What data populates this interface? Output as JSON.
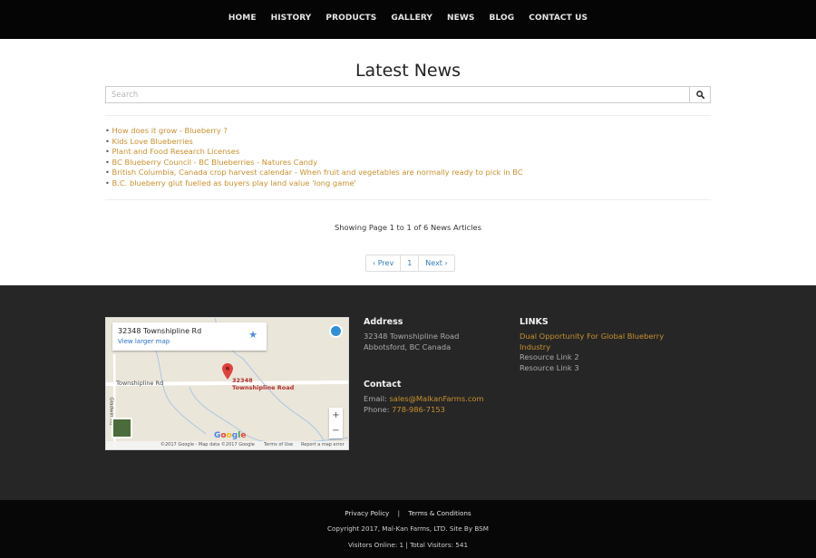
{
  "nav": {
    "items": [
      {
        "label": "HOME"
      },
      {
        "label": "HISTORY"
      },
      {
        "label": "PRODUCTS"
      },
      {
        "label": "GALLERY"
      },
      {
        "label": "NEWS"
      },
      {
        "label": "BLOG"
      },
      {
        "label": "CONTACT US"
      }
    ]
  },
  "main": {
    "title": "Latest News",
    "search_placeholder": "Search",
    "search_icon": "search-icon",
    "bullet": "•",
    "articles": [
      {
        "title": "How does it grow - Blueberry ?"
      },
      {
        "title": "Kids Love Blueberries"
      },
      {
        "title": "Plant and Food Research Licenses"
      },
      {
        "title": "BC Blueberry Council - BC Blueberries - Natures Candy"
      },
      {
        "title": "British Columbia, Canada crop harvest calendar - When fruit and vegetables are normally ready to pick in BC"
      },
      {
        "title": "B.C. blueberry glut fuelled as buyers play land value 'long game'"
      }
    ],
    "showing": "Showing Page 1 to 1 of 6 News Articles",
    "pager": {
      "prev": "‹ Prev",
      "page": "1",
      "next": "Next ›"
    }
  },
  "map": {
    "address": "32348 Townshipline Rd",
    "view_larger": "View larger map",
    "road_label": "Townshipline Rd",
    "side_road_label": "Gladwin Rd",
    "pin_label_line1": "32348",
    "pin_label_line2": "Townshipline Road",
    "zoom_in": "+",
    "zoom_out": "−",
    "logo": "Google",
    "attr_copyright": "©2017 Google - Map data ©2017 Google",
    "attr_terms": "Terms of Use",
    "attr_report": "Report a map error"
  },
  "footer": {
    "address_heading": "Address",
    "address_line1": "32348 Townshipline Road",
    "address_line2": "Abbotsford, BC Canada",
    "contact_heading": "Contact",
    "email_label": "Email: ",
    "email": "sales@MalkanFarms.com",
    "phone_label": "Phone: ",
    "phone": "778-986-7153",
    "links_heading": "LINKS",
    "links": [
      {
        "label_line1": "Dual Opportunity For Global Blueberry",
        "label_line2": "Industry"
      },
      {
        "label": "Resource Link 2"
      },
      {
        "label": "Resource Link 3"
      }
    ]
  },
  "bottom": {
    "privacy": "Privacy Policy",
    "separator": "|",
    "terms": "Terms & Conditions",
    "copyright": "Copyright 2017, Mal-Kan Farms, LTD. Site By BSM",
    "visitors": "Visitors Online: 1 | Total Visitors: 541"
  },
  "colors": {
    "accent_link": "#c9902f",
    "nav_bg": "#050505",
    "footer_bg": "#262626",
    "bottom_bg": "#070707"
  }
}
